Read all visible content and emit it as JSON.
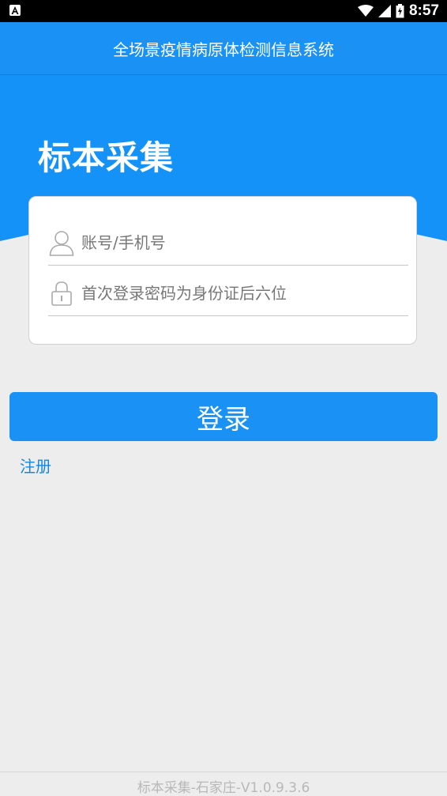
{
  "status_bar": {
    "time": "8:57"
  },
  "app_bar": {
    "title": "全场景疫情病原体检测信息系统"
  },
  "hero": {
    "title": "标本采集"
  },
  "form": {
    "account_placeholder": "账号/手机号",
    "password_placeholder": "首次登录密码为身份证后六位",
    "login_label": "登录",
    "register_label": "注册"
  },
  "footer": {
    "version_text": "标本采集-石家庄-V1.0.9.3.6"
  },
  "colors": {
    "primary": "#1a91f5",
    "link": "#1a85d6",
    "background": "#ededed"
  },
  "icons": {
    "account": "user-icon",
    "password": "lock-icon",
    "status": [
      "app-notification-icon",
      "wifi-icon",
      "signal-icon",
      "battery-icon"
    ]
  }
}
